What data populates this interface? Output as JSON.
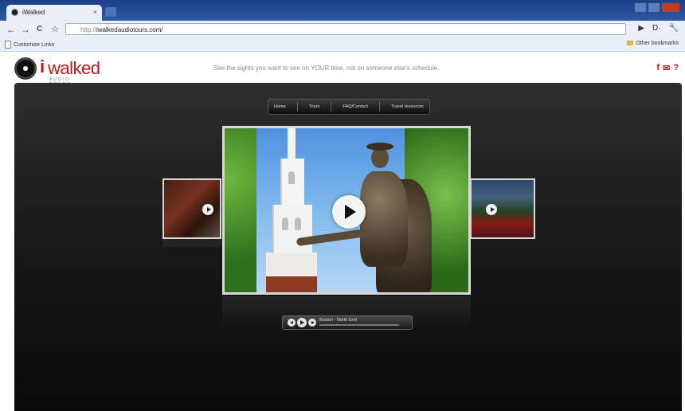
{
  "browser": {
    "tab_title": "iWalked",
    "tab_close": "×",
    "nav": {
      "back": "←",
      "forward": "→",
      "reload": "C",
      "star": "☆"
    },
    "url_scheme": "http://",
    "url_host": "iwalkedaudiotours.com/",
    "right_icons": [
      "▶",
      "D·",
      "🔧"
    ],
    "bookmarks": {
      "left": "Customize Links",
      "right": "Other bookmarks"
    }
  },
  "site": {
    "logo_text": "walked",
    "logo_i": "i",
    "logo_sub": "AUDIO TOURS",
    "tagline": "See the sights you want to see on YOUR time, not on someone else's schedule.",
    "social": [
      "f",
      "✉",
      "?"
    ]
  },
  "menu": {
    "items": [
      "Home",
      "Tours",
      "FAQ/Contact",
      "Travel resources"
    ]
  },
  "carousel": {
    "current_title": "Boston - North End"
  },
  "colors": {
    "brand_red": "#c01818",
    "stage_dark": "#1c1c1c",
    "chrome_blue": "#2c5aa8"
  }
}
